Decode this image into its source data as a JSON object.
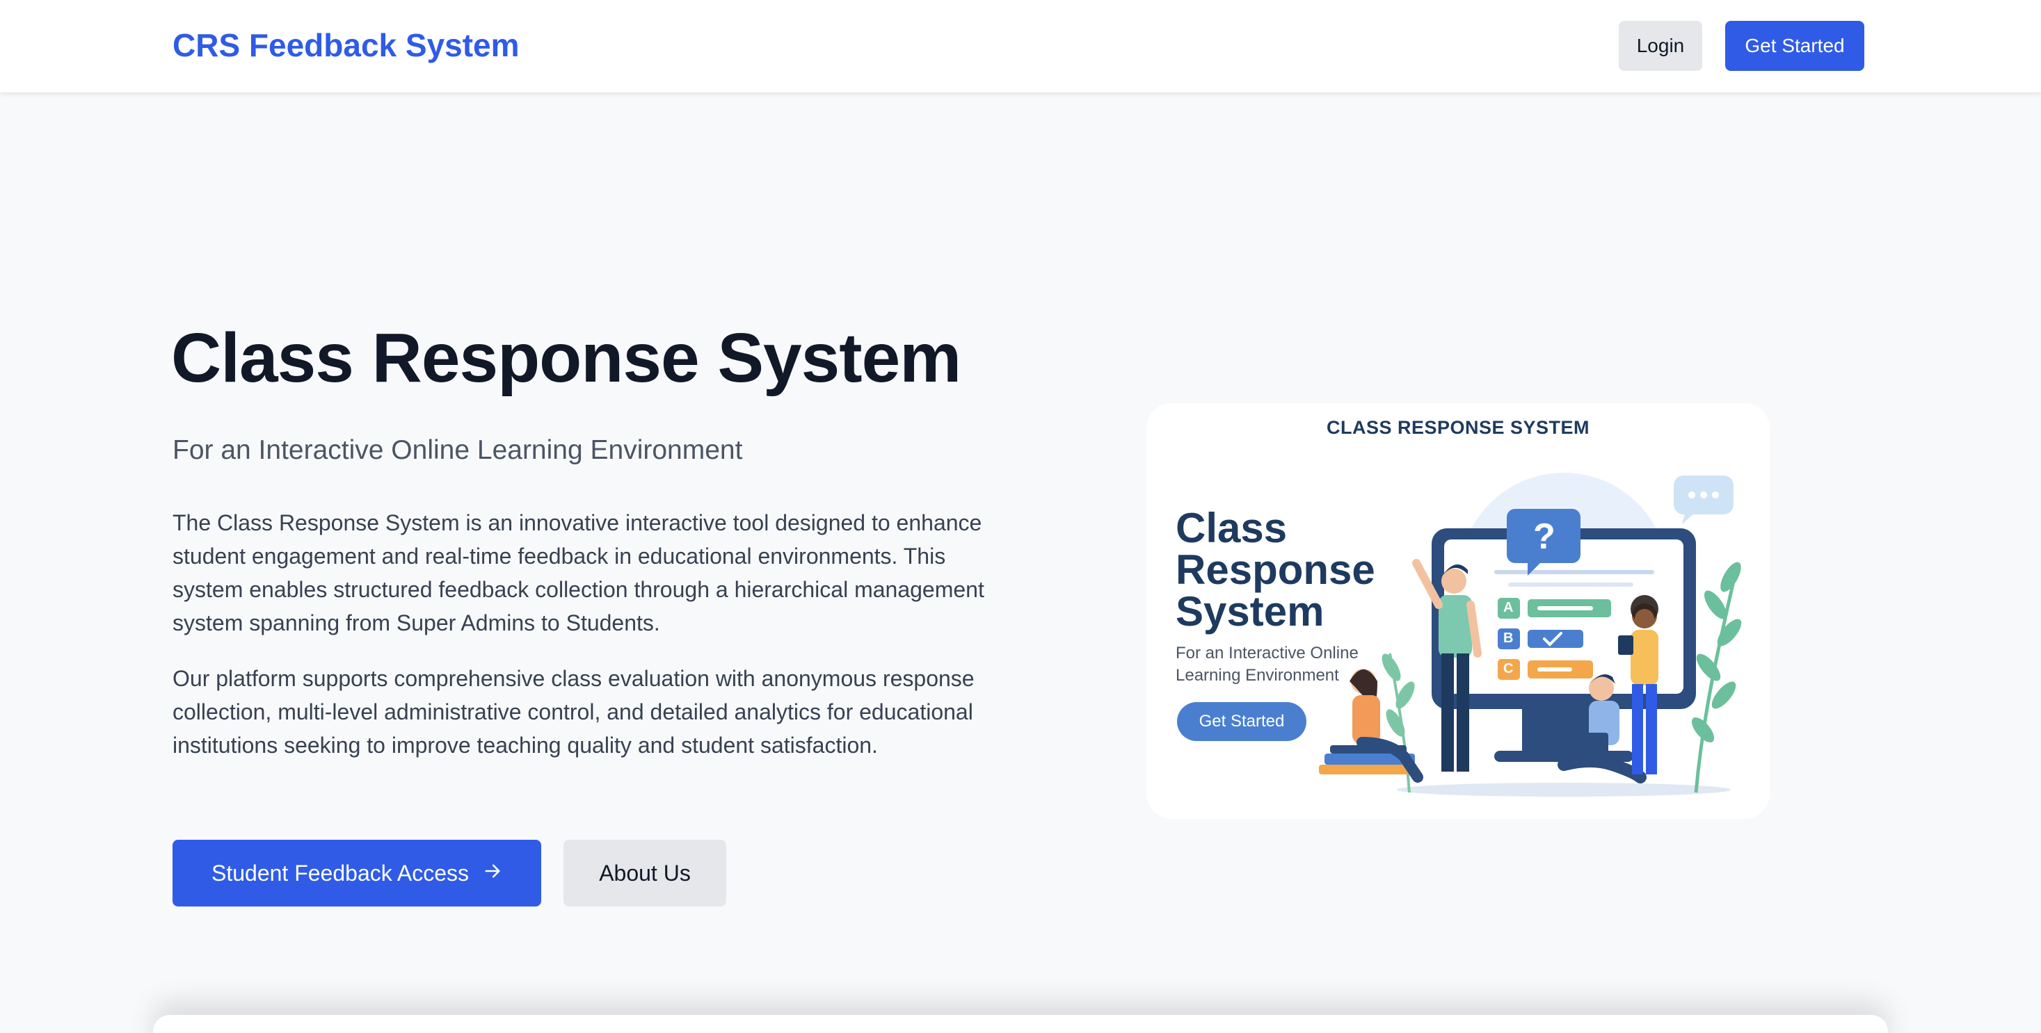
{
  "nav": {
    "brand": "CRS Feedback System",
    "login_label": "Login",
    "get_started_label": "Get Started"
  },
  "hero": {
    "title": "Class Response System",
    "subtitle": "For an Interactive Online Learning Environment",
    "paragraph1": "The Class Response System is an innovative interactive tool designed to enhance student engagement and real-time feedback in educational environments. This system enables structured feedback collection through a hierarchical management system spanning from Super Admins to Students.",
    "paragraph2": "Our platform supports comprehensive class evaluation with anonymous response collection, multi-level administrative control, and detailed analytics for educational institutions seeking to improve teaching quality and student satisfaction.",
    "primary_button": "Student Feedback Access",
    "primary_button_icon": "arrow-right-icon",
    "secondary_button": "About Us"
  },
  "illustration": {
    "header": "CLASS RESPONSE SYSTEM",
    "title_line1": "Class",
    "title_line2": "Response",
    "title_line3": "System",
    "subtitle": "For an Interactive Online Learning Environment",
    "button": "Get Started",
    "quiz_options": [
      "A",
      "B",
      "C"
    ],
    "question_mark": "?"
  },
  "colors": {
    "brand": "#2f5be6",
    "background": "#f8f9fb",
    "navy": "#1e3a5f",
    "green": "#6bbf9c",
    "orange": "#f3a64a"
  }
}
